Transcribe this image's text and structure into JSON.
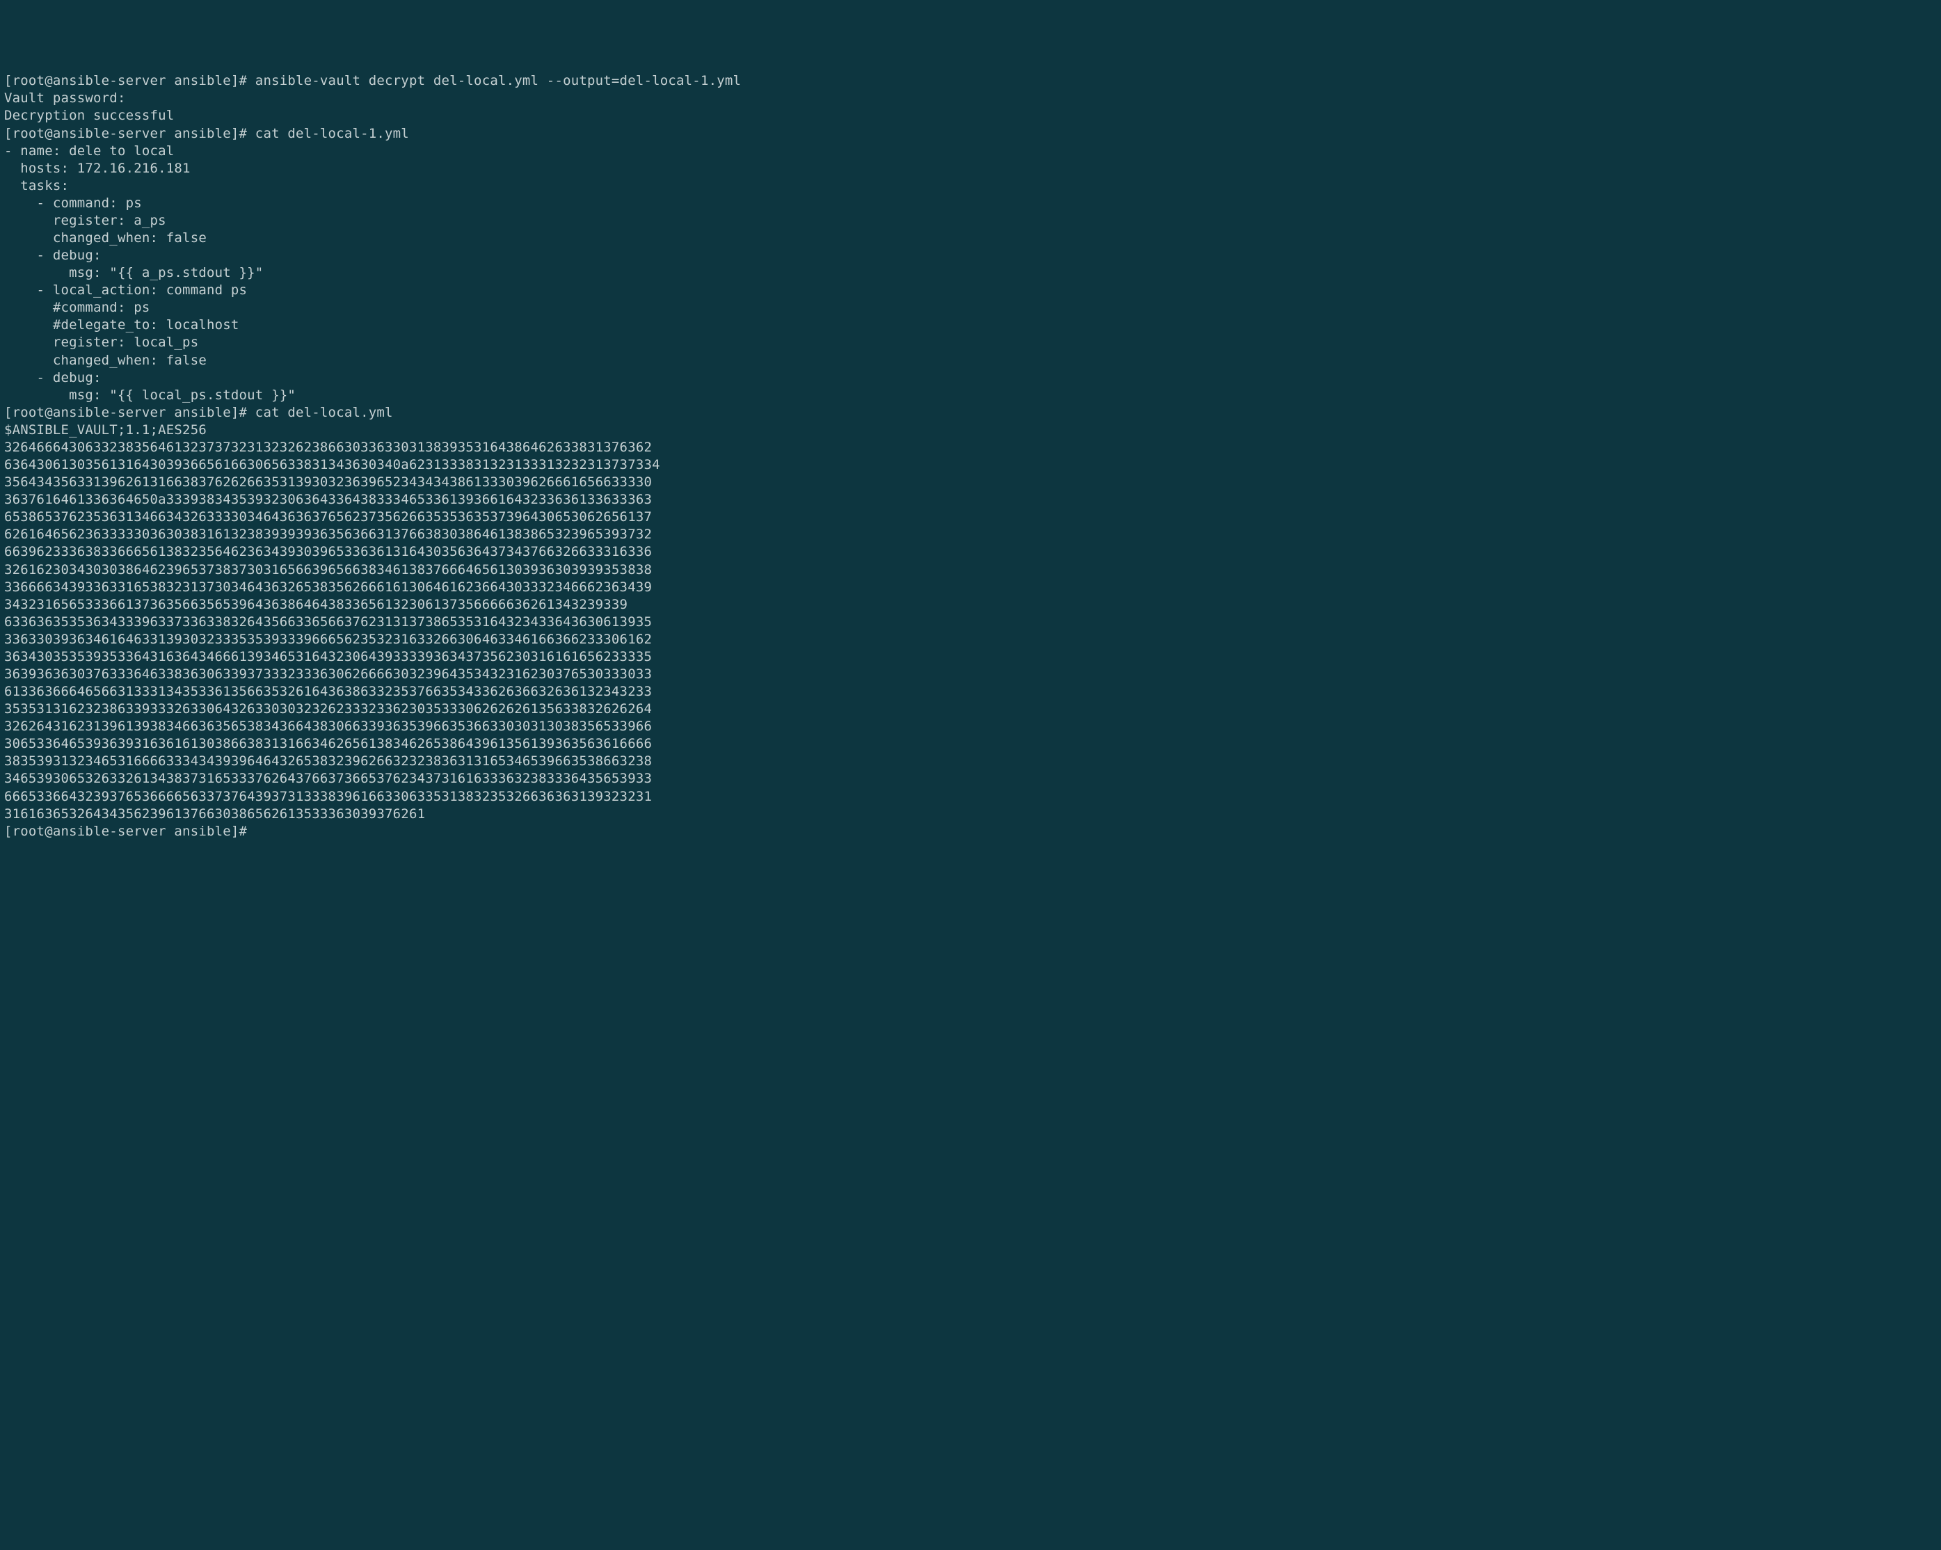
{
  "terminal": {
    "lines": [
      "[root@ansible-server ansible]# ansible-vault decrypt del-local.yml --output=del-local-1.yml",
      "Vault password:",
      "Decryption successful",
      "[root@ansible-server ansible]# cat del-local-1.yml",
      "- name: dele to local",
      "  hosts: 172.16.216.181",
      "  tasks:",
      "    - command: ps",
      "      register: a_ps",
      "      changed_when: false",
      "",
      "    - debug:",
      "        msg: \"{{ a_ps.stdout }}\"",
      "",
      "    - local_action: command ps",
      "      #command: ps",
      "      #delegate_to: localhost",
      "      register: local_ps",
      "      changed_when: false",
      "",
      "    - debug:",
      "        msg: \"{{ local_ps.stdout }}\"",
      "",
      "[root@ansible-server ansible]# cat del-local.yml",
      "$ANSIBLE_VAULT;1.1;AES256",
      "32646664306332383564613237373231323262386630336330313839353164386462633831376362",
      "6364306130356131643039366561663065633831343630340a6231333831323133313232313737334",
      "35643435633139626131663837626266353139303236396523434343861333039626661656633330",
      "3637616461336364650a333938343539323063643364383334653361393661643233636133633363",
      "65386537623536313466343263333034643636376562373562663535363537396430653062656137",
      "62616465623633333036303831613238393939363563663137663830386461383865323965393732",
      "66396233363833666561383235646236343930396533636131643035636437343766326633316336",
      "32616230343030386462396537383730316566396566383461383766646561303936303939353838",
      "33666634393363316538323137303464363265383562666161306461623664303332346662363439",
      "34323165653336613736356635653964363864643833656132306137356666636261343239339",
      "63363635353634333963373363383264356633656637623131373865353164323433643630613935",
      "33633039363461646331393032333535393339666562353231633266306463346166366233306162",
      "36343035353935336431636434666139346531643230643933339363437356230316161656233335",
      "36393636303763336463383630633937333233363062666630323964353432316230376530333033",
      "61336366646566313331343533613566353261643638633235376635343362636632636132343233",
      "35353131623238633933326330643263303032326233323362303533306262626135633832626264",
      "32626431623139613938346636356538343664383066339363539663536633030313038356533966",
      "30653364653936393163616130386638313166346265613834626538643961356139363563616666",
      "38353931323465316666333434393964643265383239626632323836313165346539663538663238",
      "34653930653263326134383731653337626437663736653762343731616333632383336435653933",
      "66653366432393765366665633737643937313338396166330633531383235326636363139323231",
      "3161636532643435623961376630386562613533363039376261",
      "[root@ansible-server ansible]#"
    ]
  }
}
